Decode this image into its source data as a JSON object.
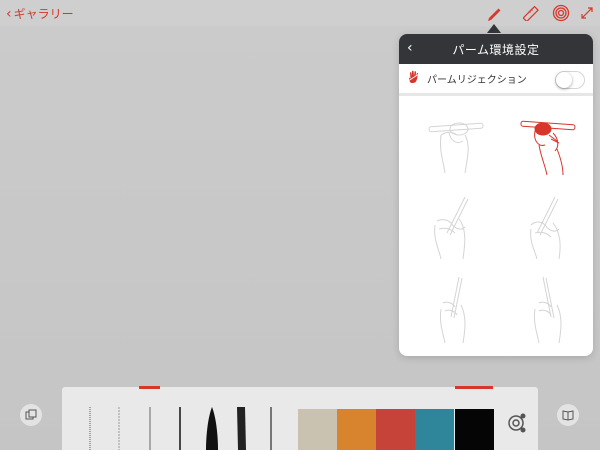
{
  "topbar": {
    "back_label": "ギャラリー",
    "icons": [
      "pencil-icon",
      "ruler-icon",
      "target-icon",
      "expand-icon"
    ],
    "accent": "#d7362b"
  },
  "popover": {
    "title": "パーム環境設定",
    "palm_rejection_label": "パームリジェクション",
    "palm_rejection_enabled": false
  },
  "colors": {
    "palette": [
      "#c9c2b0",
      "#d8842e",
      "#c6433a",
      "#2f8599",
      "#050505"
    ],
    "header_bg": "#333538"
  }
}
